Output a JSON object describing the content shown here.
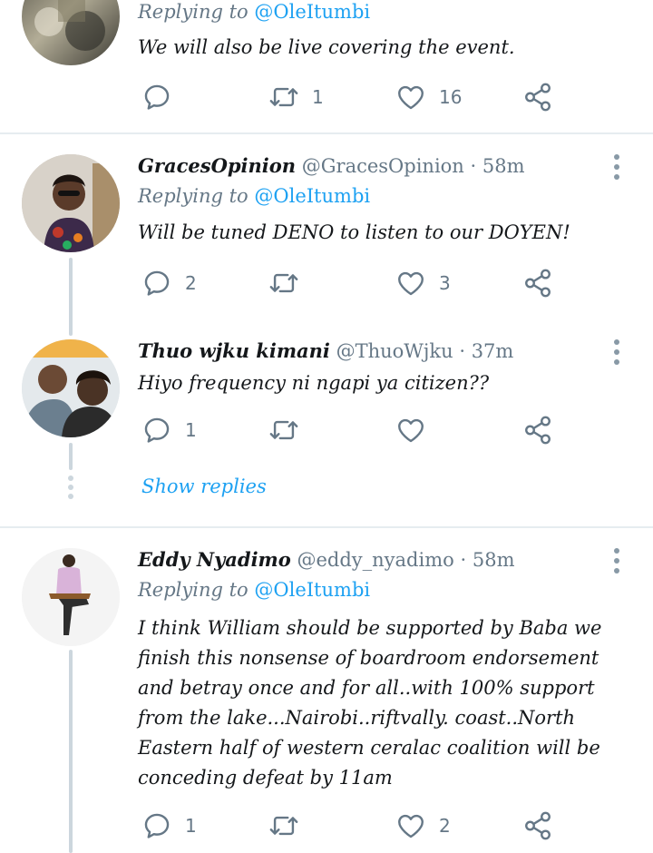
{
  "tweets": [
    {
      "reply_label": "Replying to",
      "reply_mention": "@OleItumbi",
      "text": "We will also be live covering the event.",
      "counts": {
        "reply": "",
        "retweet": "1",
        "like": "16"
      }
    },
    {
      "name": "GracesOpinion",
      "handle": "@GracesOpinion",
      "dot": "·",
      "time": "58m",
      "reply_label": "Replying to",
      "reply_mention": "@OleItumbi",
      "text": "Will be tuned DENO to listen to our DOYEN!",
      "counts": {
        "reply": "2",
        "retweet": "",
        "like": "3"
      }
    },
    {
      "name": "Thuo wjku kimani",
      "handle": "@ThuoWjku",
      "dot": "·",
      "time": "37m",
      "text": "Hiyo frequency ni ngapi ya citizen??",
      "counts": {
        "reply": "1",
        "retweet": "",
        "like": ""
      }
    },
    {
      "name": "Eddy Nyadimo",
      "handle": "@eddy_nyadimo",
      "dot": "·",
      "time": "58m",
      "reply_label": "Replying to",
      "reply_mention": "@OleItumbi",
      "text": "I think William should be supported by Baba  we finish this nonsense of boardroom endorsement and betray once and for all..with 100% support from the lake...Nairobi..riftvally.  coast..North Eastern half of western ceralac coalition will be conceding defeat by 11am",
      "counts": {
        "reply": "1",
        "retweet": "",
        "like": "2"
      }
    }
  ],
  "show_replies": "Show replies",
  "icons": {
    "reply": "reply-bubble-icon",
    "retweet": "retweet-icon",
    "like": "heart-icon",
    "share": "share-icon",
    "more": "more-vertical-icon"
  },
  "colors": {
    "accent": "#1da1f2",
    "muted": "#657786",
    "icon": "#657786",
    "separator": "#e6ecf0"
  }
}
